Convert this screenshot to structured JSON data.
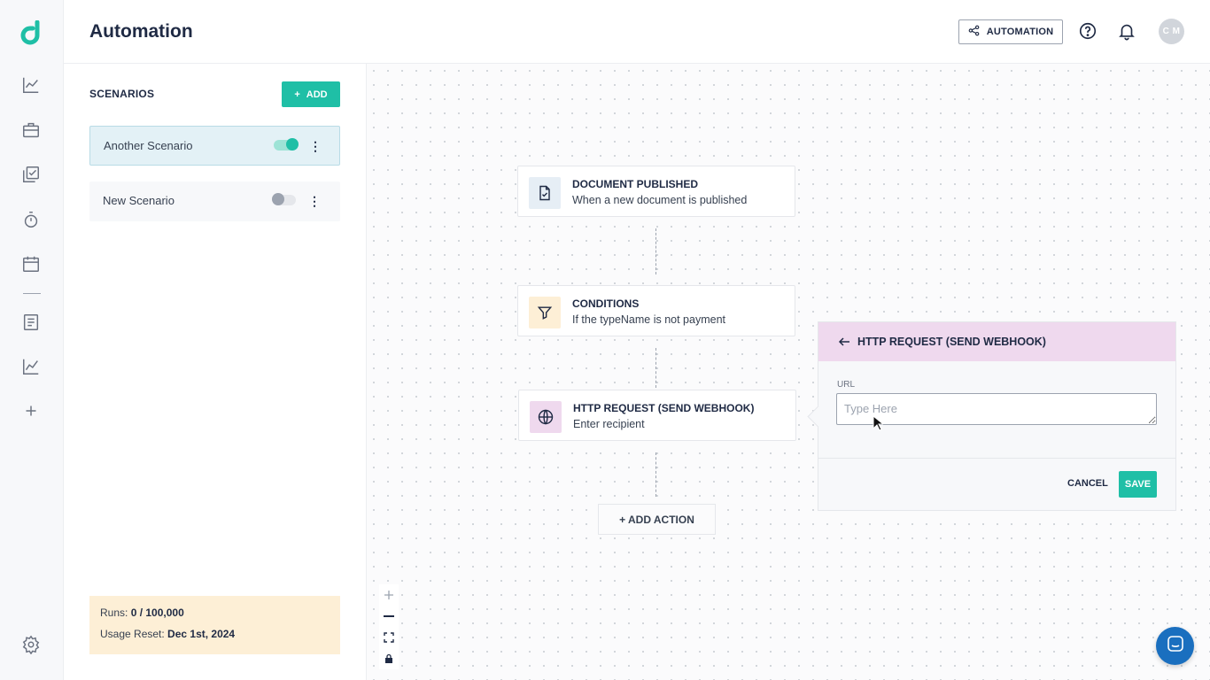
{
  "header": {
    "title": "Automation",
    "automation_button": "AUTOMATION",
    "avatar_initials": "C M"
  },
  "scenarios": {
    "title": "SCENARIOS",
    "add_label": "ADD",
    "items": [
      {
        "name": "Another Scenario",
        "enabled": true
      },
      {
        "name": "New Scenario",
        "enabled": false
      }
    ],
    "usage": {
      "runs_label": "Runs:",
      "runs_value": "0 / 100,000",
      "reset_label": "Usage Reset:",
      "reset_value": "Dec 1st, 2024"
    }
  },
  "flow": {
    "nodes": [
      {
        "title": "DOCUMENT PUBLISHED",
        "subtitle": "When a new document is published",
        "icon": "document-check-icon",
        "color": "#e6eef5"
      },
      {
        "title": "CONDITIONS",
        "subtitle": "If the typeName is not payment",
        "icon": "filter-icon",
        "color": "#fdefd6"
      },
      {
        "title": "HTTP REQUEST (SEND WEBHOOK)",
        "subtitle": "Enter recipient",
        "icon": "globe-icon",
        "color": "#efd9ee"
      }
    ],
    "add_action_label": "+ ADD ACTION"
  },
  "config_panel": {
    "title": "HTTP REQUEST (SEND WEBHOOK)",
    "url_label": "URL",
    "url_value": "",
    "url_placeholder": "Type Here",
    "cancel_label": "CANCEL",
    "save_label": "SAVE"
  },
  "colors": {
    "accent": "#1fbfa6",
    "chat": "#1a6fbf"
  }
}
